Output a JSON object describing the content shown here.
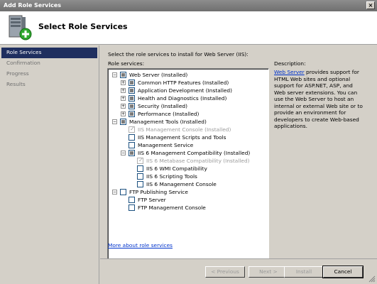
{
  "window": {
    "title": "Add Role Services",
    "close_glyph": "×"
  },
  "header": {
    "title": "Select Role Services",
    "icon": "server-add-icon"
  },
  "sidebar": {
    "items": [
      {
        "label": "Role Services",
        "active": true
      },
      {
        "label": "Confirmation",
        "active": false
      },
      {
        "label": "Progress",
        "active": false
      },
      {
        "label": "Results",
        "active": false
      }
    ]
  },
  "content": {
    "instruction": "Select the role services to install for Web Server (IIS):",
    "role_services_label": "Role services:",
    "tree": [
      {
        "label": "Web Server  (Installed)",
        "level": 0,
        "expander": "−",
        "check": "partial",
        "disabled": false
      },
      {
        "label": "Common HTTP Features  (Installed)",
        "level": 1,
        "expander": "+",
        "check": "partial",
        "disabled": false
      },
      {
        "label": "Application Development  (Installed)",
        "level": 1,
        "expander": "+",
        "check": "partial",
        "disabled": false
      },
      {
        "label": "Health and Diagnostics  (Installed)",
        "level": 1,
        "expander": "+",
        "check": "partial",
        "disabled": false
      },
      {
        "label": "Security  (Installed)",
        "level": 1,
        "expander": "+",
        "check": "partial",
        "disabled": false
      },
      {
        "label": "Performance  (Installed)",
        "level": 1,
        "expander": "+",
        "check": "partial",
        "disabled": false
      },
      {
        "label": "Management Tools  (Installed)",
        "level": 0,
        "expander": "−",
        "check": "partial",
        "disabled": false
      },
      {
        "label": "IIS Management Console  (Installed)",
        "level": 1,
        "expander": "",
        "check": "checked",
        "disabled": true
      },
      {
        "label": "IIS Management Scripts and Tools",
        "level": 1,
        "expander": "",
        "check": "unchecked",
        "disabled": false
      },
      {
        "label": "Management Service",
        "level": 1,
        "expander": "",
        "check": "unchecked",
        "disabled": false
      },
      {
        "label": "IIS 6 Management Compatibility  (Installed)",
        "level": 1,
        "expander": "−",
        "check": "partial",
        "disabled": false
      },
      {
        "label": "IIS 6 Metabase Compatibility  (Installed)",
        "level": 2,
        "expander": "",
        "check": "checked",
        "disabled": true
      },
      {
        "label": "IIS 6 WMI Compatibility",
        "level": 2,
        "expander": "",
        "check": "unchecked",
        "disabled": false
      },
      {
        "label": "IIS 6 Scripting Tools",
        "level": 2,
        "expander": "",
        "check": "unchecked",
        "disabled": false
      },
      {
        "label": "IIS 6 Management Console",
        "level": 2,
        "expander": "",
        "check": "unchecked",
        "disabled": false
      },
      {
        "label": "FTP Publishing Service",
        "level": 0,
        "expander": "−",
        "check": "unchecked",
        "disabled": false
      },
      {
        "label": "FTP Server",
        "level": 1,
        "expander": "",
        "check": "unchecked",
        "disabled": false
      },
      {
        "label": "FTP Management Console",
        "level": 1,
        "expander": "",
        "check": "unchecked",
        "disabled": false
      }
    ],
    "description_label": "Description:",
    "description_link": "Web Server",
    "description_text": " provides support for HTML Web sites and optional support for ASP.NET, ASP, and Web server extensions. You can use the Web Server to host an internal or external Web site or to provide an environment for developers to create Web-based applications.",
    "more_link": "More about role services"
  },
  "footer": {
    "previous": "< Previous",
    "next": "Next >",
    "install": "Install",
    "cancel": "Cancel"
  }
}
